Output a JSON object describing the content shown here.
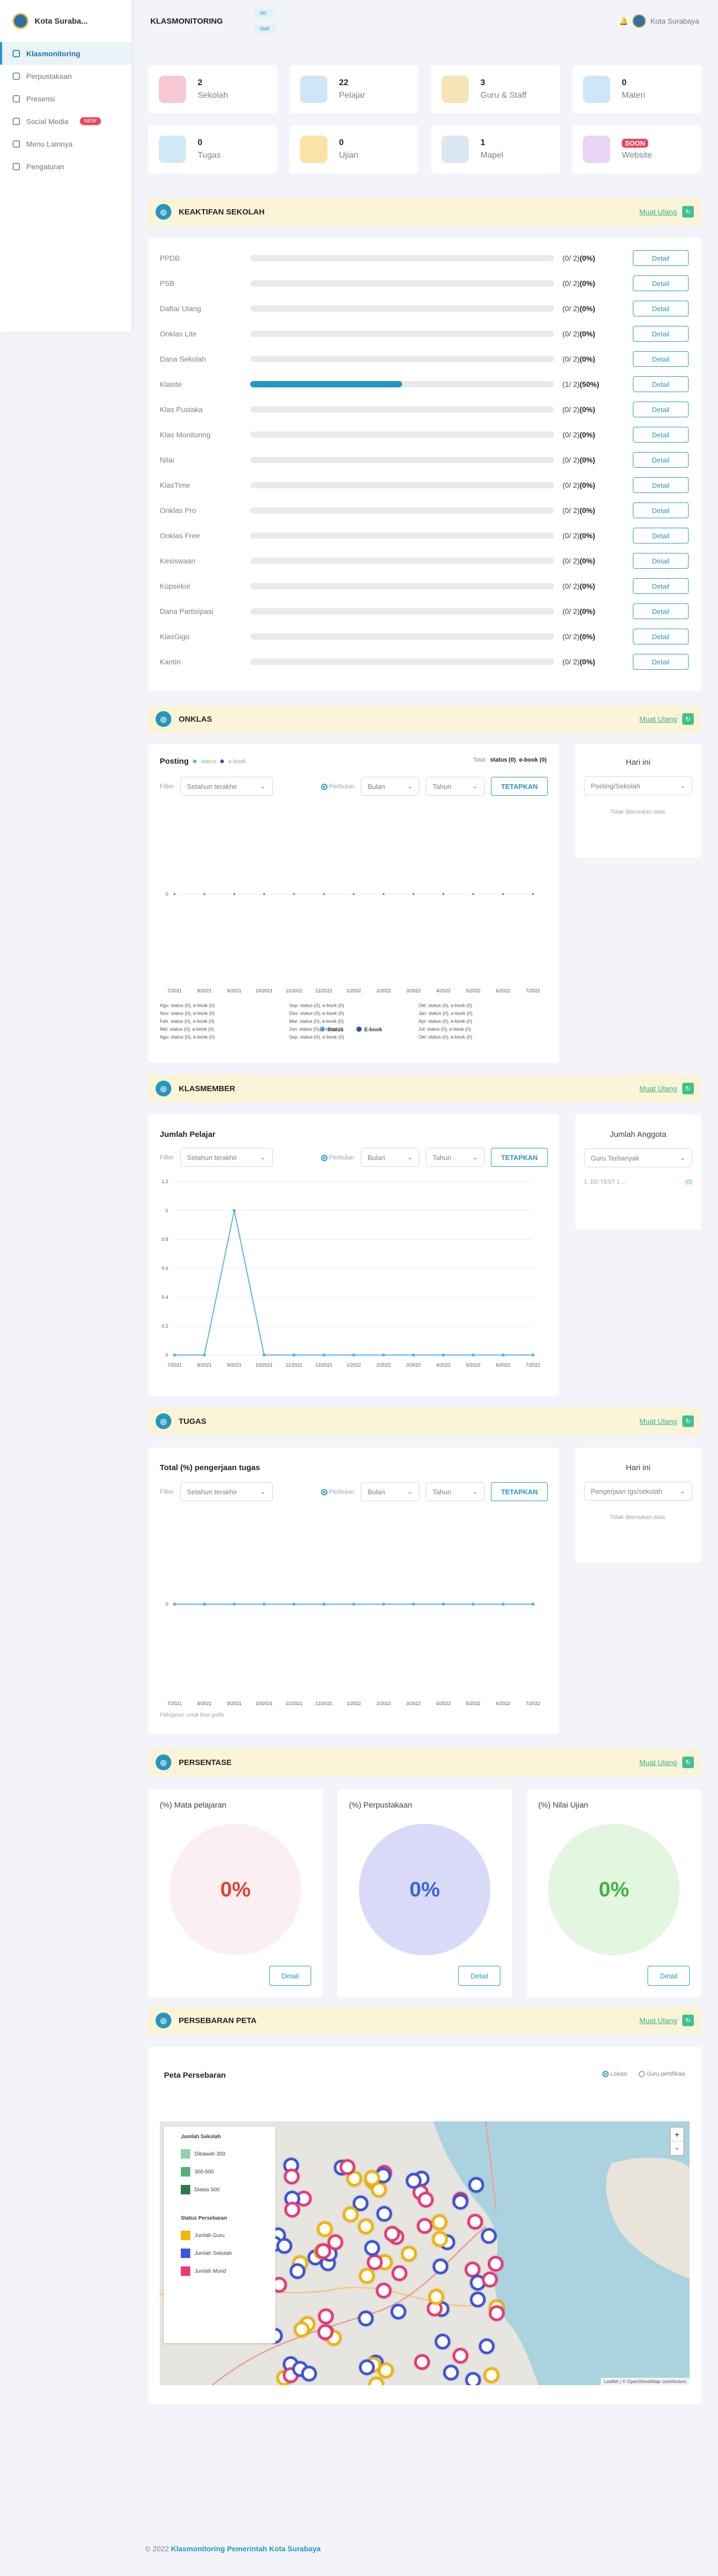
{
  "sidebar": {
    "brand": "Kota Suraba...",
    "items": [
      {
        "label": "Klasmonitoring",
        "active": true
      },
      {
        "label": "Perpustakaan"
      },
      {
        "label": "Presensi"
      },
      {
        "label": "Social Media",
        "badge": "NEW"
      },
      {
        "label": "Menu Lainnya"
      },
      {
        "label": "Pengaturan"
      }
    ]
  },
  "topbar": {
    "title": "KLASMONITORING",
    "tags": [
      "SD",
      "SMP"
    ],
    "user": "Kota Surabaya"
  },
  "stats": [
    {
      "num": "2",
      "label": "Sekolah",
      "color": "#f6c8d3"
    },
    {
      "num": "22",
      "label": "Pelajar",
      "color": "#cfe6f8"
    },
    {
      "num": "3",
      "label": "Guru & Staff",
      "color": "#f7e3b5"
    },
    {
      "num": "0",
      "label": "Materi",
      "color": "#cfe6f8"
    },
    {
      "num": "0",
      "label": "Tugas",
      "color": "#cfeaf4"
    },
    {
      "num": "0",
      "label": "Ujian",
      "color": "#fbe3a6"
    },
    {
      "num": "1",
      "label": "Mapel",
      "color": "#dbe7f3"
    },
    {
      "num": "SOON",
      "label": "Website",
      "color": "#e8d4f4",
      "soon": true
    }
  ],
  "common": {
    "muat": "Muat Ulang",
    "detail": "Detail",
    "tetapkan": "TETAPKAN",
    "filter": "Filter",
    "periode": "Setahun terakhir",
    "perbulan": "Perbulan",
    "bulan": "Bulan",
    "tahun": "Tahun"
  },
  "sections": {
    "keaktifan": "KEAKTIFAN SEKOLAH",
    "onklas": "ONKLAS",
    "klasmember": "KLASMEMBER",
    "tugas": "TUGAS",
    "persentase": "PERSENTASE",
    "peta": "PERSEBARAN PETA"
  },
  "activities": [
    {
      "name": "PPDB",
      "count": "(0/ 2)",
      "pct": "(0%)",
      "value": 0
    },
    {
      "name": "PSB",
      "count": "(0/ 2)",
      "pct": "(0%)",
      "value": 0
    },
    {
      "name": "Daftar Ulang",
      "count": "(0/ 2)",
      "pct": "(0%)",
      "value": 0
    },
    {
      "name": "Onklas Lite",
      "count": "(0/ 2)",
      "pct": "(0%)",
      "value": 0
    },
    {
      "name": "Dana Sekolah",
      "count": "(0/ 2)",
      "pct": "(0%)",
      "value": 0
    },
    {
      "name": "Klasite",
      "count": "(1/ 2)",
      "pct": "(50%)",
      "value": 50
    },
    {
      "name": "Klas Pustaka",
      "count": "(0/ 2)",
      "pct": "(0%)",
      "value": 0
    },
    {
      "name": "Klas Monitoring",
      "count": "(0/ 2)",
      "pct": "(0%)",
      "value": 0
    },
    {
      "name": "Nilai",
      "count": "(0/ 2)",
      "pct": "(0%)",
      "value": 0
    },
    {
      "name": "KlasTime",
      "count": "(0/ 2)",
      "pct": "(0%)",
      "value": 0
    },
    {
      "name": "Onklas Pro",
      "count": "(0/ 2)",
      "pct": "(0%)",
      "value": 0
    },
    {
      "name": "Onklas Free",
      "count": "(0/ 2)",
      "pct": "(0%)",
      "value": 0
    },
    {
      "name": "Kesiswaan",
      "count": "(0/ 2)",
      "pct": "(0%)",
      "value": 0
    },
    {
      "name": "Kopsekol",
      "count": "(0/ 2)",
      "pct": "(0%)",
      "value": 0
    },
    {
      "name": "Dana Partisipasi",
      "count": "(0/ 2)",
      "pct": "(0%)",
      "value": 0
    },
    {
      "name": "KlasGigo",
      "count": "(0/ 2)",
      "pct": "(0%)",
      "value": 0
    },
    {
      "name": "Kantin",
      "count": "(0/ 2)",
      "pct": "(0%)",
      "value": 0
    }
  ],
  "onklas": {
    "title": "Posting",
    "legend": [
      "status",
      "e-book"
    ],
    "total": "Total :",
    "total_status": "status (0)",
    "total_ebook": "e-book (0)",
    "side_title": "Hari ini",
    "side_select": "Posting/Sekolah",
    "side_empty": "Tidak ditemukan data.",
    "summary": [
      "Agu: status (0), e-book (0)",
      "Sep: status (0), e-book (0)",
      "Okt: status (0), e-book (0)",
      "Nov: status (0), e-book (0)",
      "Des: status (0), e-book (0)",
      "Jan: status (0), e-book (0)",
      "Feb: status (0), e-book (0)",
      "Mar: status (0), e-book (0)",
      "Apr: status (0), e-book (0)",
      "Mei: status (0), e-book (0)",
      "Jun: status (0), e-book (0)",
      "Jul: status (0), e-book (0)",
      "Agu: status (0), e-book (0)",
      "Sep: status (0), e-book (0)",
      "Okt: status (0), e-book (0)"
    ]
  },
  "klasmember": {
    "title": "Jumlah Pelajar",
    "side_title": "Jumlah Anggota",
    "side_select": "Guru Terbanyak",
    "side_item": "1. DD TEST 1 ...",
    "side_value": "(0)"
  },
  "tugas": {
    "title": "Total (%) pengerjaan tugas",
    "side_title": "Hari ini",
    "side_select": "Pengerjaan tgs/sekolah",
    "side_empty": "Tidak ditemukan data.",
    "note": "Pilih/geser untuk lihat grafik"
  },
  "persentase": [
    {
      "title": "(%) Mata pelajaran",
      "value": "0%",
      "bg": "#fbeff1",
      "fg": "#e0413a"
    },
    {
      "title": "(%) Perpustakaan",
      "value": "0%",
      "bg": "#d8daf8",
      "fg": "#3d63d8"
    },
    {
      "title": "(%) Nilai Ujian",
      "value": "0%",
      "bg": "#e3f6df",
      "fg": "#45b04c"
    }
  ],
  "peta": {
    "title": "Peta Persebaran",
    "radio_lokasi": "Lokasi",
    "radio_guru": "Guru pertifikasi",
    "legend1_title": "Jumlah Sekolah",
    "legend1": [
      "Dibawah 300",
      "300-500",
      "Diatas 500"
    ],
    "legend2_title": "Status Persebaran",
    "legend2": [
      "Jumlah Guru",
      "Jumlah Sekolah",
      "Jumlah Murid"
    ],
    "zoom_in": "+",
    "zoom_out": "-",
    "attribution": "Leaflet | © OpenStreetMap contributors"
  },
  "footer": {
    "year": "© 2022",
    "text": "Klasmonitoring Pemerintah Kota Surabaya"
  },
  "chart_data": [
    {
      "type": "line",
      "title": "Posting",
      "categories": [
        "7/2021",
        "8/2021",
        "9/2021",
        "10/2021",
        "11/2021",
        "12/2021",
        "1/2022",
        "2/2022",
        "3/2022",
        "4/2022",
        "5/2022",
        "6/2022",
        "7/2022"
      ],
      "series": [
        {
          "name": "Status",
          "values": [
            0,
            0,
            0,
            0,
            0,
            0,
            0,
            0,
            0,
            0,
            0,
            0,
            0
          ]
        },
        {
          "name": "E-book",
          "values": [
            0,
            0,
            0,
            0,
            0,
            0,
            0,
            0,
            0,
            0,
            0,
            0,
            0
          ]
        }
      ],
      "yticks": [
        0
      ]
    },
    {
      "type": "line",
      "title": "Jumlah Pelajar",
      "categories": [
        "7/2021",
        "8/2021",
        "9/2021",
        "10/2021",
        "11/2021",
        "12/2021",
        "1/2022",
        "2/2022",
        "3/2022",
        "4/2022",
        "5/2022",
        "6/2022",
        "7/2022"
      ],
      "series": [
        {
          "values": [
            0,
            0,
            1,
            0,
            0,
            0,
            0,
            0,
            0,
            0,
            0,
            0,
            0
          ]
        }
      ],
      "ylim": [
        0,
        1.2
      ],
      "yticks": [
        0,
        0.2,
        0.4,
        0.6,
        0.8,
        1,
        1.2
      ]
    },
    {
      "type": "line",
      "title": "Total (%) pengerjaan tugas",
      "categories": [
        "7/2021",
        "8/2021",
        "9/2021",
        "10/2021",
        "11/2021",
        "12/2021",
        "1/2022",
        "2/2022",
        "3/2022",
        "4/2022",
        "5/2022",
        "6/2022",
        "7/2022"
      ],
      "series": [
        {
          "values": [
            0,
            0,
            0,
            0,
            0,
            0,
            0,
            0,
            0,
            0,
            0,
            0,
            0
          ]
        }
      ],
      "yticks": [
        0
      ]
    }
  ]
}
